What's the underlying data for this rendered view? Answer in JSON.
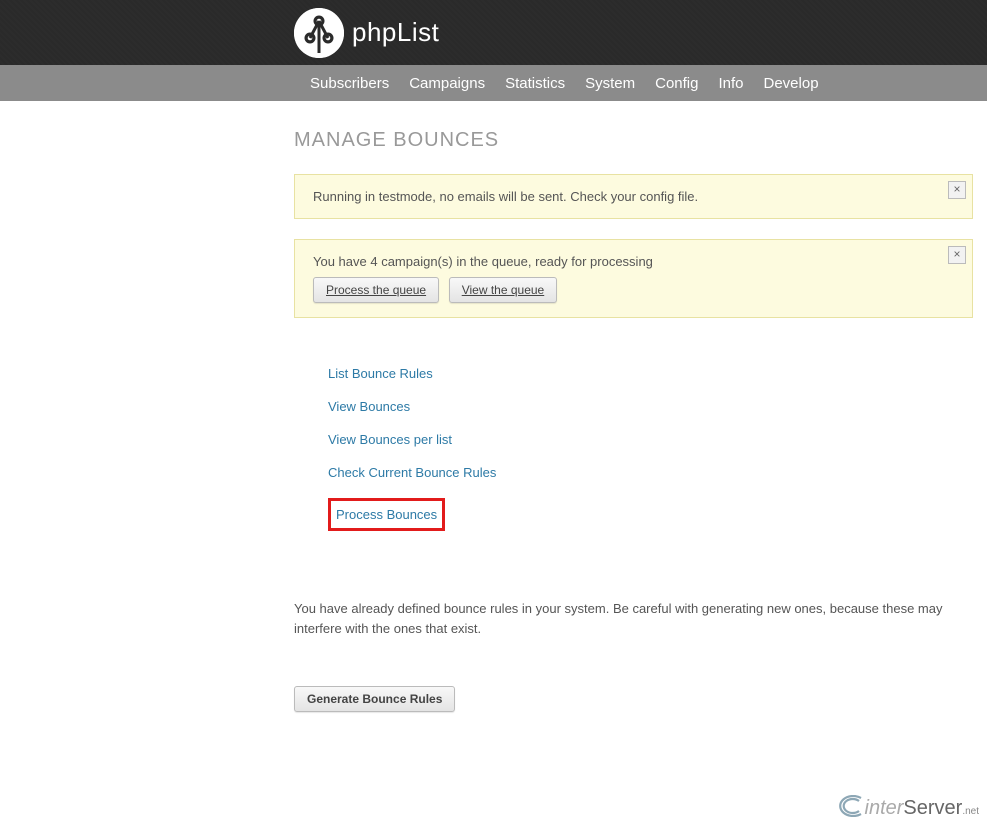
{
  "brand": {
    "name_light": "php",
    "name_bold": "List"
  },
  "nav": {
    "items": [
      {
        "label": "Subscribers"
      },
      {
        "label": "Campaigns"
      },
      {
        "label": "Statistics"
      },
      {
        "label": "System"
      },
      {
        "label": "Config"
      },
      {
        "label": "Info"
      },
      {
        "label": "Develop"
      }
    ]
  },
  "page": {
    "title": "MANAGE BOUNCES"
  },
  "notices": {
    "testmode": {
      "text": "Running in testmode, no emails will be sent. Check your config file."
    },
    "queue": {
      "text": "You have 4 campaign(s) in the queue, ready for processing",
      "process_btn": "Process the queue",
      "view_btn": "View the queue"
    }
  },
  "links": [
    {
      "label": "List Bounce Rules",
      "highlight": false
    },
    {
      "label": "View Bounces",
      "highlight": false
    },
    {
      "label": "View Bounces per list",
      "highlight": false
    },
    {
      "label": "Check Current Bounce Rules",
      "highlight": false
    },
    {
      "label": "Process Bounces",
      "highlight": true
    }
  ],
  "body_text": "You have already defined bounce rules in your system. Be careful with generating new ones, because these may interfere with the ones that exist.",
  "generate_btn": "Generate Bounce Rules",
  "footer": {
    "inter": "inter",
    "server": "Server",
    "net": ".net"
  }
}
